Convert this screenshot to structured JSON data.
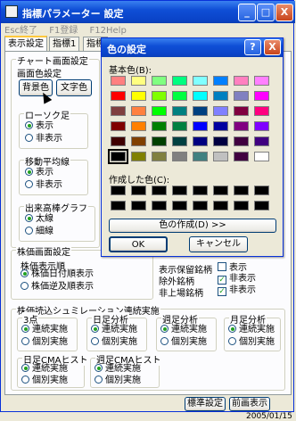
{
  "window": {
    "title": "指標パラメーター 設定",
    "min": "_",
    "max": "□",
    "close": "X"
  },
  "menu": [
    "Esc終了",
    "F1登録",
    "F12Help"
  ],
  "tabs": [
    "表示設定",
    "指標1",
    "指標"
  ],
  "chart_group": {
    "label": "チャート画面設定",
    "color_label": "画面色設定",
    "bg_button": "背景色",
    "text_button": "文字色"
  },
  "candle": {
    "label": "ローソク足",
    "options": [
      "表示",
      "非表示"
    ],
    "selected": 0
  },
  "ma": {
    "label": "移動平均線",
    "options": [
      "表示",
      "非表示"
    ],
    "selected": 0
  },
  "volume": {
    "label": "出来高棒グラフ",
    "options": [
      "太線",
      "細線"
    ],
    "selected": 0
  },
  "stock_screen": {
    "label": "株価画面設定",
    "sub_label": "株価表示順",
    "options": [
      "株価日付順表示",
      "株価逆及順表示"
    ],
    "selected": 0
  },
  "display_opts": {
    "items": [
      {
        "label": "表示保留銘柄",
        "check_label": "表示",
        "checked": false
      },
      {
        "label": "除外銘柄",
        "check_label": "非表示",
        "checked": true
      },
      {
        "label": "非上場銘柄",
        "check_label": "非表示",
        "checked": true
      }
    ]
  },
  "sim": {
    "label": "株価読込シュミレーション連続実施",
    "groups": [
      {
        "label": "3点",
        "options": [
          "連続実施",
          "個別実施"
        ],
        "selected": 0
      },
      {
        "label": "日足分析",
        "options": [
          "連続実施",
          "個別実施"
        ],
        "selected": 0
      },
      {
        "label": "週足分析",
        "options": [
          "連続実施",
          "個別実施"
        ],
        "selected": 0
      },
      {
        "label": "月足分析",
        "options": [
          "連続実施",
          "個別実施"
        ],
        "selected": 0
      },
      {
        "label": "日足CMAヒスト",
        "options": [
          "連続実施",
          "個別実施"
        ],
        "selected": 0
      },
      {
        "label": "週足CMAヒスト",
        "options": [
          "連続実施",
          "個別実施"
        ],
        "selected": 0
      }
    ]
  },
  "bottom_buttons": {
    "standard": "標準設定",
    "prev": "前画表示"
  },
  "date_text": "2005/01/15",
  "color_dialog": {
    "title": "色の設定",
    "help": "?",
    "close": "X",
    "basic_label": "基本色(B):",
    "custom_label": "作成した色(C):",
    "define_button": "色の作成(D) >>",
    "ok": "OK",
    "cancel": "キャンセル",
    "basic_colors": [
      [
        "#ff8080",
        "#ffff80",
        "#80ff80",
        "#00ff80",
        "#80ffff",
        "#0080ff",
        "#ff80c0",
        "#ff80ff"
      ],
      [
        "#ff0000",
        "#ffff00",
        "#80ff00",
        "#00ff40",
        "#00ffff",
        "#0080c0",
        "#8080c0",
        "#ff00ff"
      ],
      [
        "#804040",
        "#ff8040",
        "#00ff00",
        "#008080",
        "#004080",
        "#8080ff",
        "#800040",
        "#ff0080"
      ],
      [
        "#800000",
        "#ff8000",
        "#008000",
        "#008040",
        "#0000ff",
        "#0000a0",
        "#800080",
        "#8000ff"
      ],
      [
        "#400000",
        "#804000",
        "#004000",
        "#004040",
        "#000080",
        "#000040",
        "#400040",
        "#400080"
      ],
      [
        "#000000",
        "#808000",
        "#808040",
        "#808080",
        "#408080",
        "#c0c0c0",
        "#400040",
        "#ffffff"
      ]
    ],
    "selected_color": "#000000"
  }
}
